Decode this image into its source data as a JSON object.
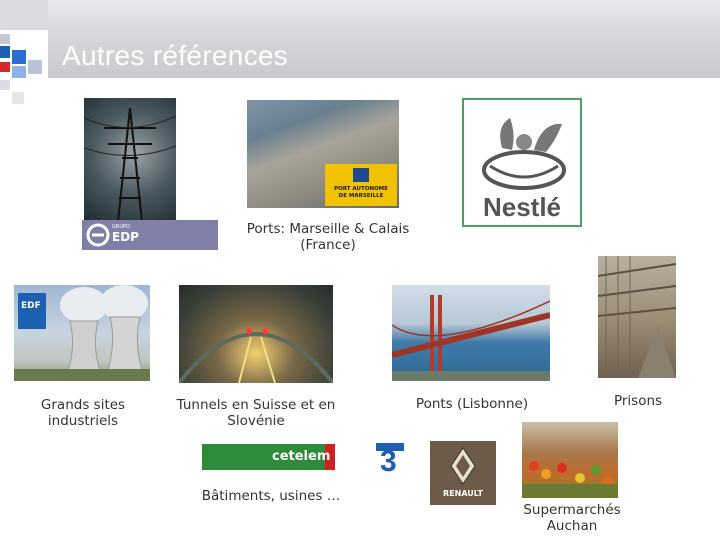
{
  "slide": {
    "title": "Autres références",
    "logos": {
      "edp": "EDP",
      "edp_small": "GRUPO",
      "port": "PORT AUTONOME DE MARSEILLE",
      "nestle": "Nestlé",
      "edf": "EDF",
      "cetelem": "cetelem",
      "france3": "3",
      "renault": "RENAULT"
    },
    "captions": {
      "ports": "Ports: Marseille & Calais (France)",
      "grands_sites": "Grands sites industriels",
      "tunnels": "Tunnels en Suisse et en Slovénie",
      "ponts": "Ponts (Lisbonne)",
      "prisons": "Prisons",
      "batiments": "Bâtiments, usines …",
      "supermarches": "Supermarchés Auchan"
    },
    "colors": {
      "accent_blue": "#1d5fb0",
      "edp_purple": "#7f7fa8",
      "cetelem_green": "#2e8b3a",
      "cetelem_red": "#d32020"
    }
  }
}
